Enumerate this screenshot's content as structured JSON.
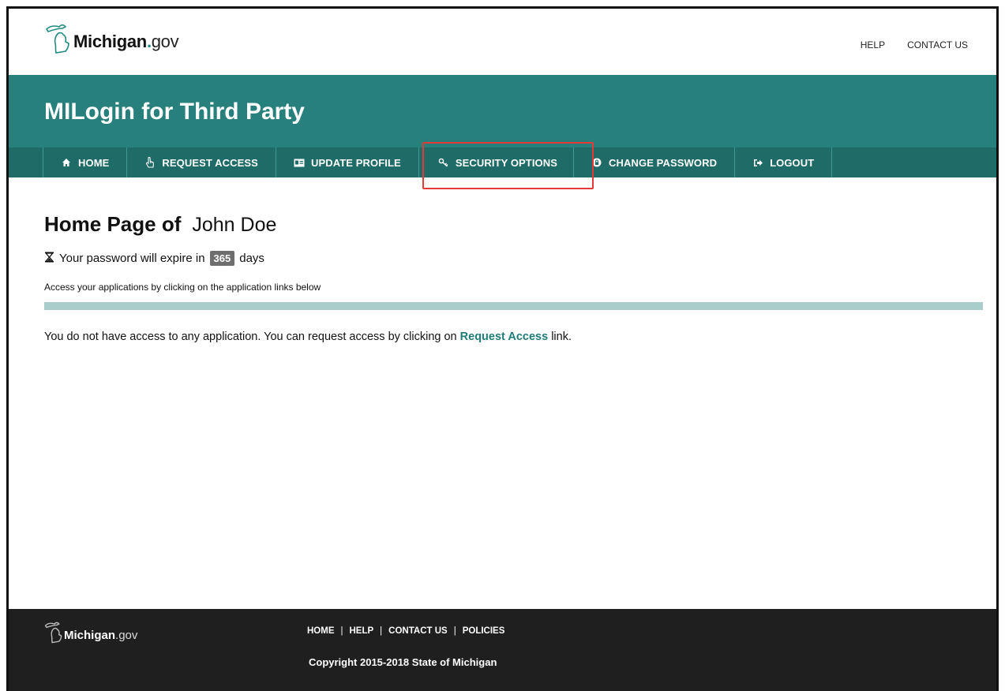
{
  "header": {
    "logo": {
      "brand": "Michigan",
      "dot": ".",
      "suffix": "gov"
    },
    "links": [
      "HELP",
      "CONTACT US"
    ]
  },
  "banner": {
    "title": "MILogin for Third Party"
  },
  "nav": {
    "items": [
      {
        "label": "HOME",
        "icon": "home-icon"
      },
      {
        "label": "REQUEST ACCESS",
        "icon": "hand-pointer-icon"
      },
      {
        "label": "UPDATE PROFILE",
        "icon": "id-card-icon"
      },
      {
        "label": "SECURITY OPTIONS",
        "icon": "key-icon"
      },
      {
        "label": "CHANGE PASSWORD",
        "icon": "lock-icon"
      },
      {
        "label": "LOGOUT",
        "icon": "sign-out-icon"
      }
    ],
    "highlighted": "SECURITY OPTIONS"
  },
  "main": {
    "title_prefix": "Home Page of",
    "user_name": "John Doe",
    "expire_prefix": "Your password will expire in",
    "expire_days": "365",
    "expire_suffix": "days",
    "access_note": "Access your applications by clicking on the application links below",
    "message_prefix": "You do not have access to any application. You can request access by clicking on",
    "message_link": "Request Access",
    "message_suffix": "link."
  },
  "footer": {
    "logo": {
      "brand": "Michigan",
      "dot": ".",
      "suffix": "gov"
    },
    "links": [
      "HOME",
      "HELP",
      "CONTACT US",
      "POLICIES"
    ],
    "separator": "|",
    "copyright": "Copyright 2015-2018 State of Michigan"
  },
  "colors": {
    "banner": "#27807b",
    "nav": "#1f6b68",
    "divider": "#a9cdca",
    "link": "#1f7c76",
    "footer": "#1f1f1f",
    "highlight": "#e53935"
  }
}
